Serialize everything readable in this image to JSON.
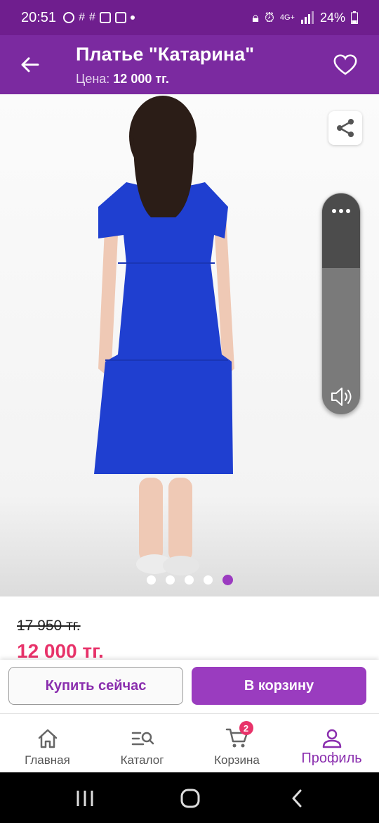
{
  "status_bar": {
    "time": "20:51",
    "network": "4G+",
    "battery": "24%"
  },
  "header": {
    "title": "Платье \"Катарина\"",
    "price_label": "Цена:",
    "price_value": "12 000 тг."
  },
  "product": {
    "image_alt": "Blue dress, back view",
    "gallery": {
      "count": 5,
      "active_index": 4
    }
  },
  "pricing": {
    "old_price": "17 950 тг.",
    "new_price": "12 000 тг."
  },
  "actions": {
    "buy_now": "Купить сейчас",
    "add_to_cart": "В корзину"
  },
  "bottom_nav": {
    "items": [
      {
        "label": "Главная",
        "icon": "home-icon"
      },
      {
        "label": "Каталог",
        "icon": "catalog-search-icon"
      },
      {
        "label": "Корзина",
        "icon": "cart-icon",
        "badge": "2"
      },
      {
        "label": "Профиль",
        "icon": "profile-icon",
        "active": true
      }
    ]
  },
  "colors": {
    "primary": "#7b2aa0",
    "accent": "#9a3cbf",
    "price": "#e8336a",
    "dress": "#1f3fd0"
  }
}
